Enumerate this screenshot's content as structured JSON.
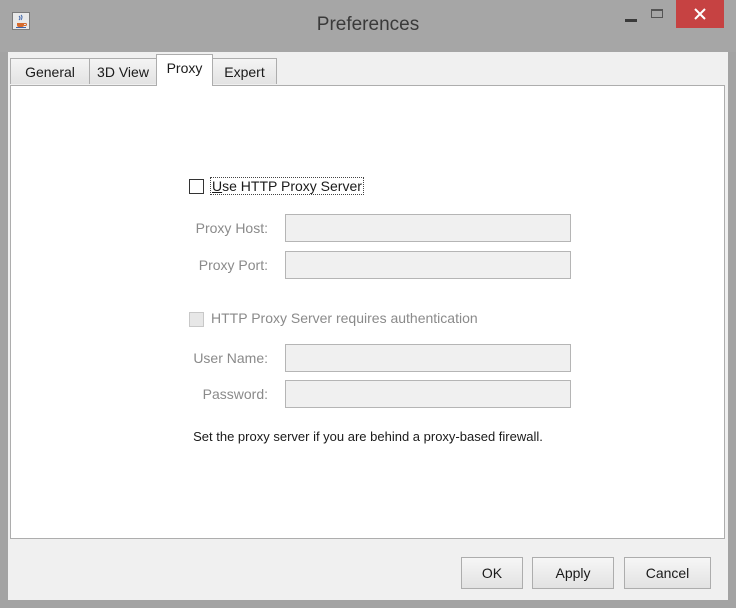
{
  "window": {
    "title": "Preferences"
  },
  "tabs": [
    {
      "label": "General",
      "active": false
    },
    {
      "label": "3D View",
      "active": false
    },
    {
      "label": "Proxy",
      "active": true
    },
    {
      "label": "Expert",
      "active": false
    }
  ],
  "proxy": {
    "use_proxy": {
      "label_mnemonic": "U",
      "label_rest": "se HTTP Proxy Server",
      "checked": false
    },
    "host": {
      "label": "Proxy Host:",
      "value": ""
    },
    "port": {
      "label": "Proxy Port:",
      "value": ""
    },
    "auth": {
      "label": "HTTP Proxy Server requires authentication",
      "checked": false,
      "enabled": false
    },
    "username": {
      "label": "User Name:",
      "value": ""
    },
    "password": {
      "label": "Password:",
      "value": ""
    },
    "hint": "Set the proxy server if you are behind a proxy-based firewall."
  },
  "buttons": {
    "ok": "OK",
    "apply": "Apply",
    "cancel": "Cancel"
  },
  "colors": {
    "close_button": "#c64242",
    "title_bar": "#a6a6a6",
    "disabled_text": "#8a8a8a"
  },
  "icons": [
    "java-cup-icon",
    "minimize-icon",
    "maximize-icon",
    "close-icon"
  ]
}
